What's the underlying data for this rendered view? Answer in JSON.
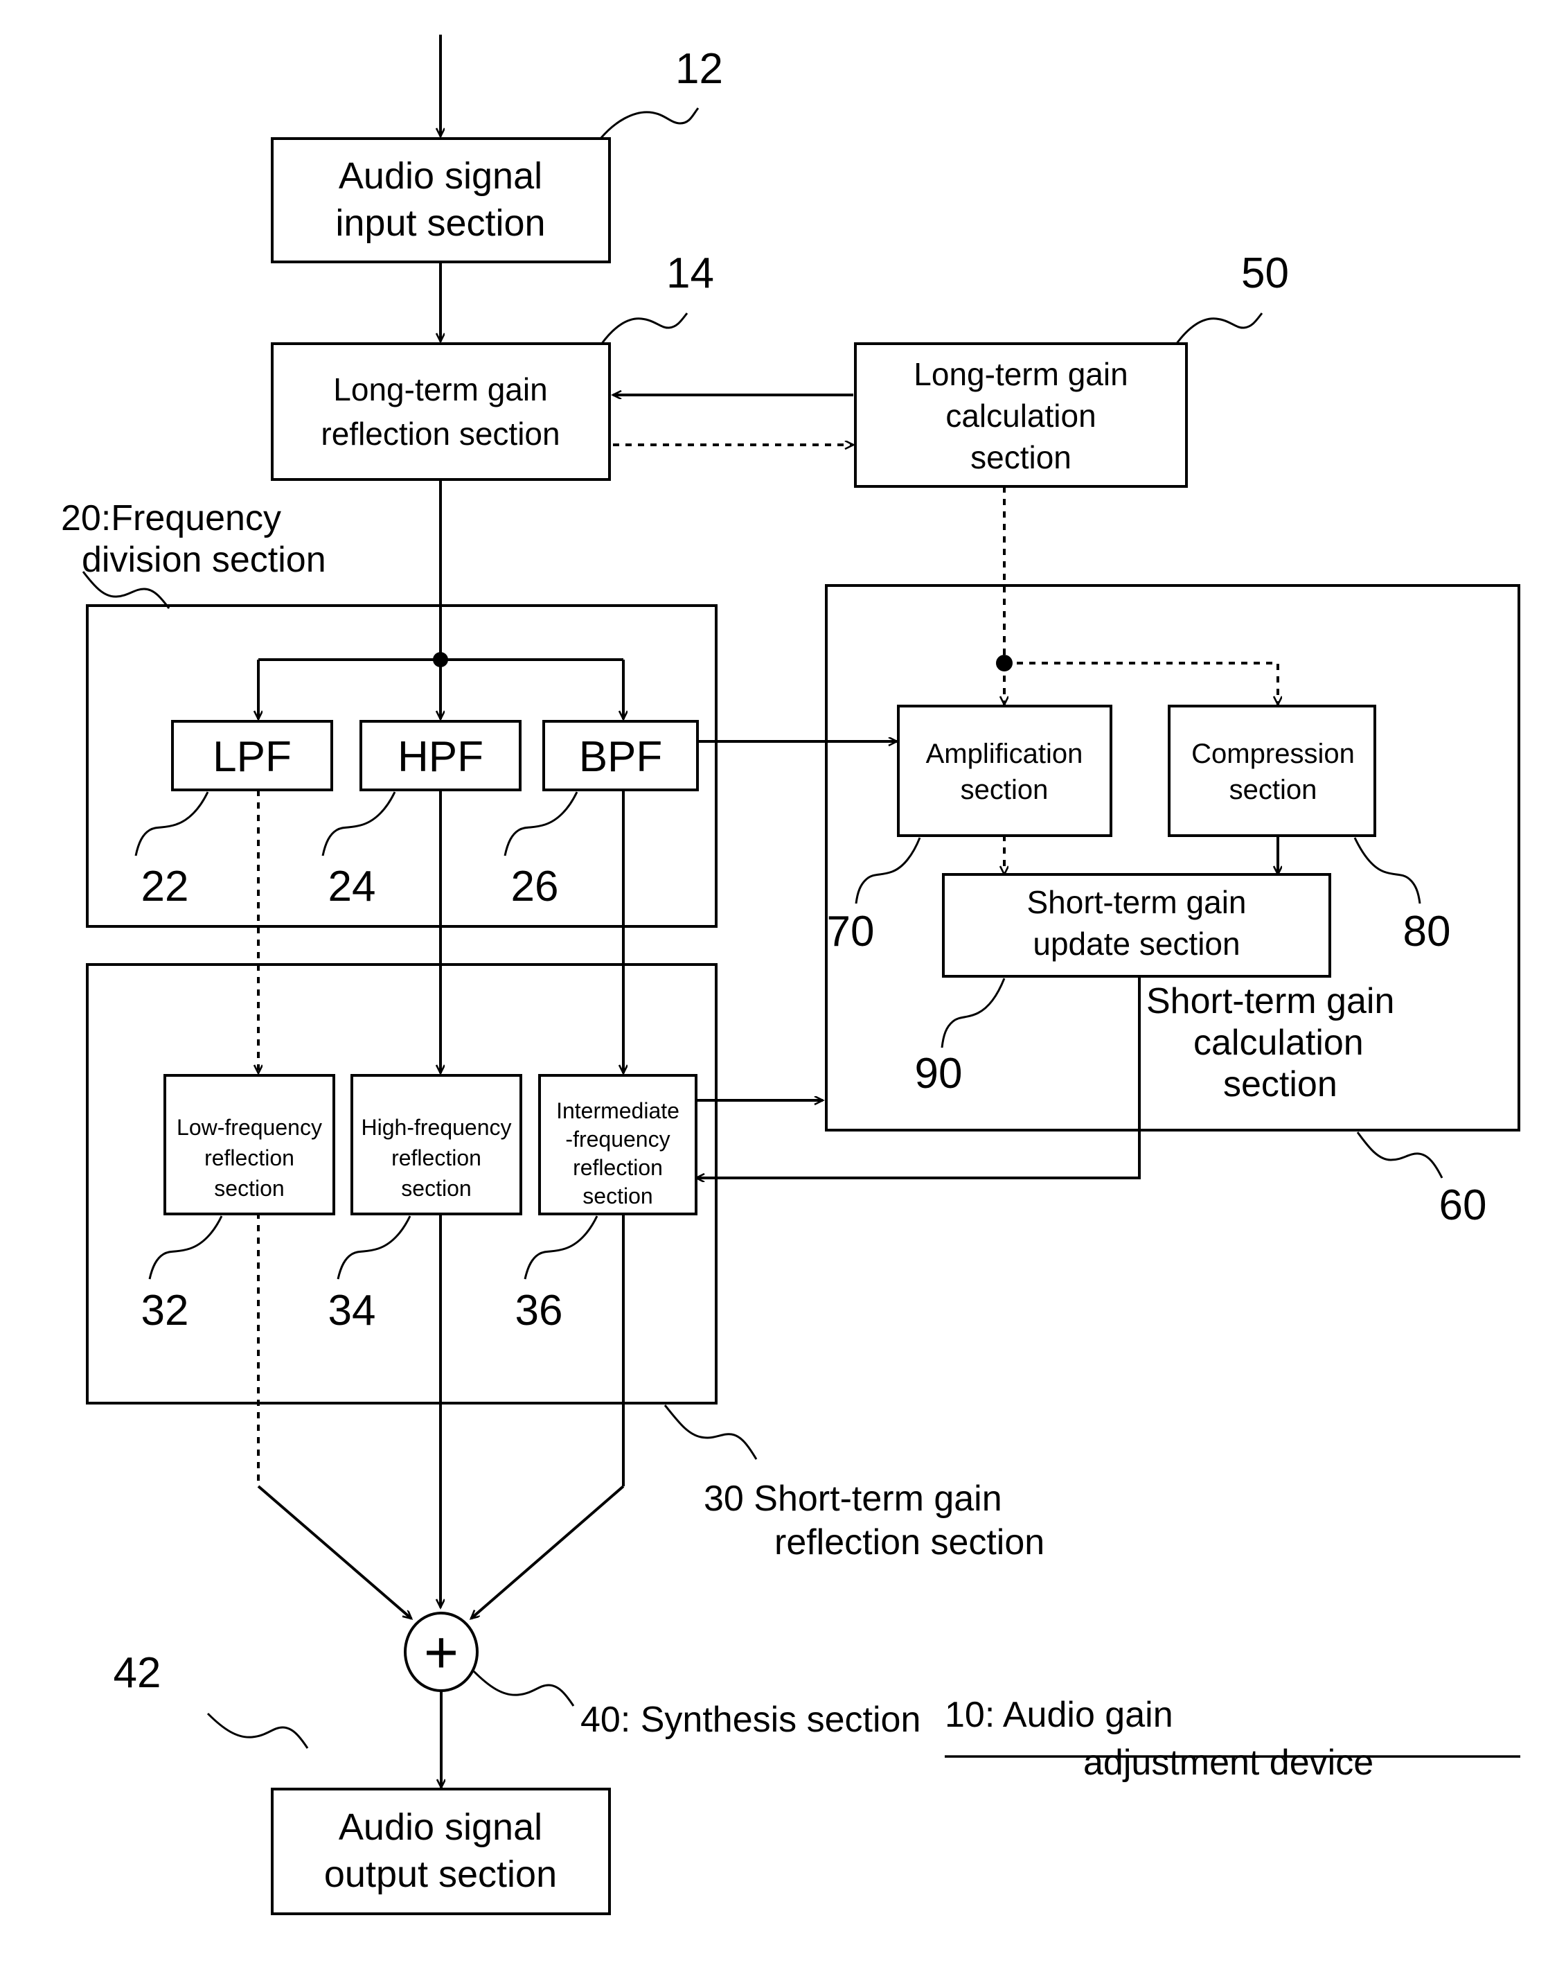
{
  "figure": {
    "title_ref": "10",
    "device_label_line1": "10: Audio gain",
    "device_label_line2": "adjustment device"
  },
  "blocks": {
    "audio_input": {
      "ref": "12",
      "line1": "Audio signal",
      "line2": "input section"
    },
    "long_term_reflect": {
      "ref": "14",
      "line1": "Long-term gain",
      "line2": "reflection section"
    },
    "long_term_calc": {
      "ref": "50",
      "line1": "Long-term gain",
      "line2": "calculation",
      "line3": "section"
    },
    "lpf": {
      "ref": "22",
      "label": "LPF"
    },
    "hpf": {
      "ref": "24",
      "label": "HPF"
    },
    "bpf": {
      "ref": "26",
      "label": "BPF"
    },
    "amplification": {
      "ref": "70",
      "line1": "Amplification",
      "line2": "section"
    },
    "compression": {
      "ref": "80",
      "line1": "Compression",
      "line2": "section"
    },
    "short_term_update": {
      "ref": "90",
      "line1": "Short-term gain",
      "line2": "update section"
    },
    "low_freq_reflect": {
      "ref": "32",
      "line1": "Low-frequency",
      "line2": "reflection",
      "line3": "section"
    },
    "high_freq_reflect": {
      "ref": "34",
      "line1": "High-frequency",
      "line2": "reflection",
      "line3": "section"
    },
    "mid_freq_reflect": {
      "ref": "36",
      "line1": "Intermediate",
      "line2": "-frequency",
      "line3": "reflection",
      "line4": "section"
    },
    "audio_output": {
      "ref": "42",
      "line1": "Audio signal",
      "line2": "output section"
    },
    "adder": {
      "ref": "40",
      "symbol": "+",
      "label": "40: Synthesis section"
    }
  },
  "groups": {
    "frequency_division": {
      "ref": "20",
      "line1": "20:Frequency",
      "line2": "division section"
    },
    "short_term_reflection": {
      "ref": "30",
      "line1": "30 Short-term gain",
      "line2": "reflection section"
    },
    "short_term_calculation": {
      "ref": "60",
      "line1": "Short-term gain",
      "line2": "calculation",
      "line3": "section"
    }
  },
  "refs": {
    "r12": "12",
    "r14": "14",
    "r20": "20",
    "r22": "22",
    "r24": "24",
    "r26": "26",
    "r30": "30",
    "r32": "32",
    "r34": "34",
    "r36": "36",
    "r40": "40",
    "r42": "42",
    "r50": "50",
    "r60": "60",
    "r70": "70",
    "r80": "80",
    "r90": "90"
  },
  "colors": {
    "line": "#000000",
    "background": "#ffffff"
  }
}
